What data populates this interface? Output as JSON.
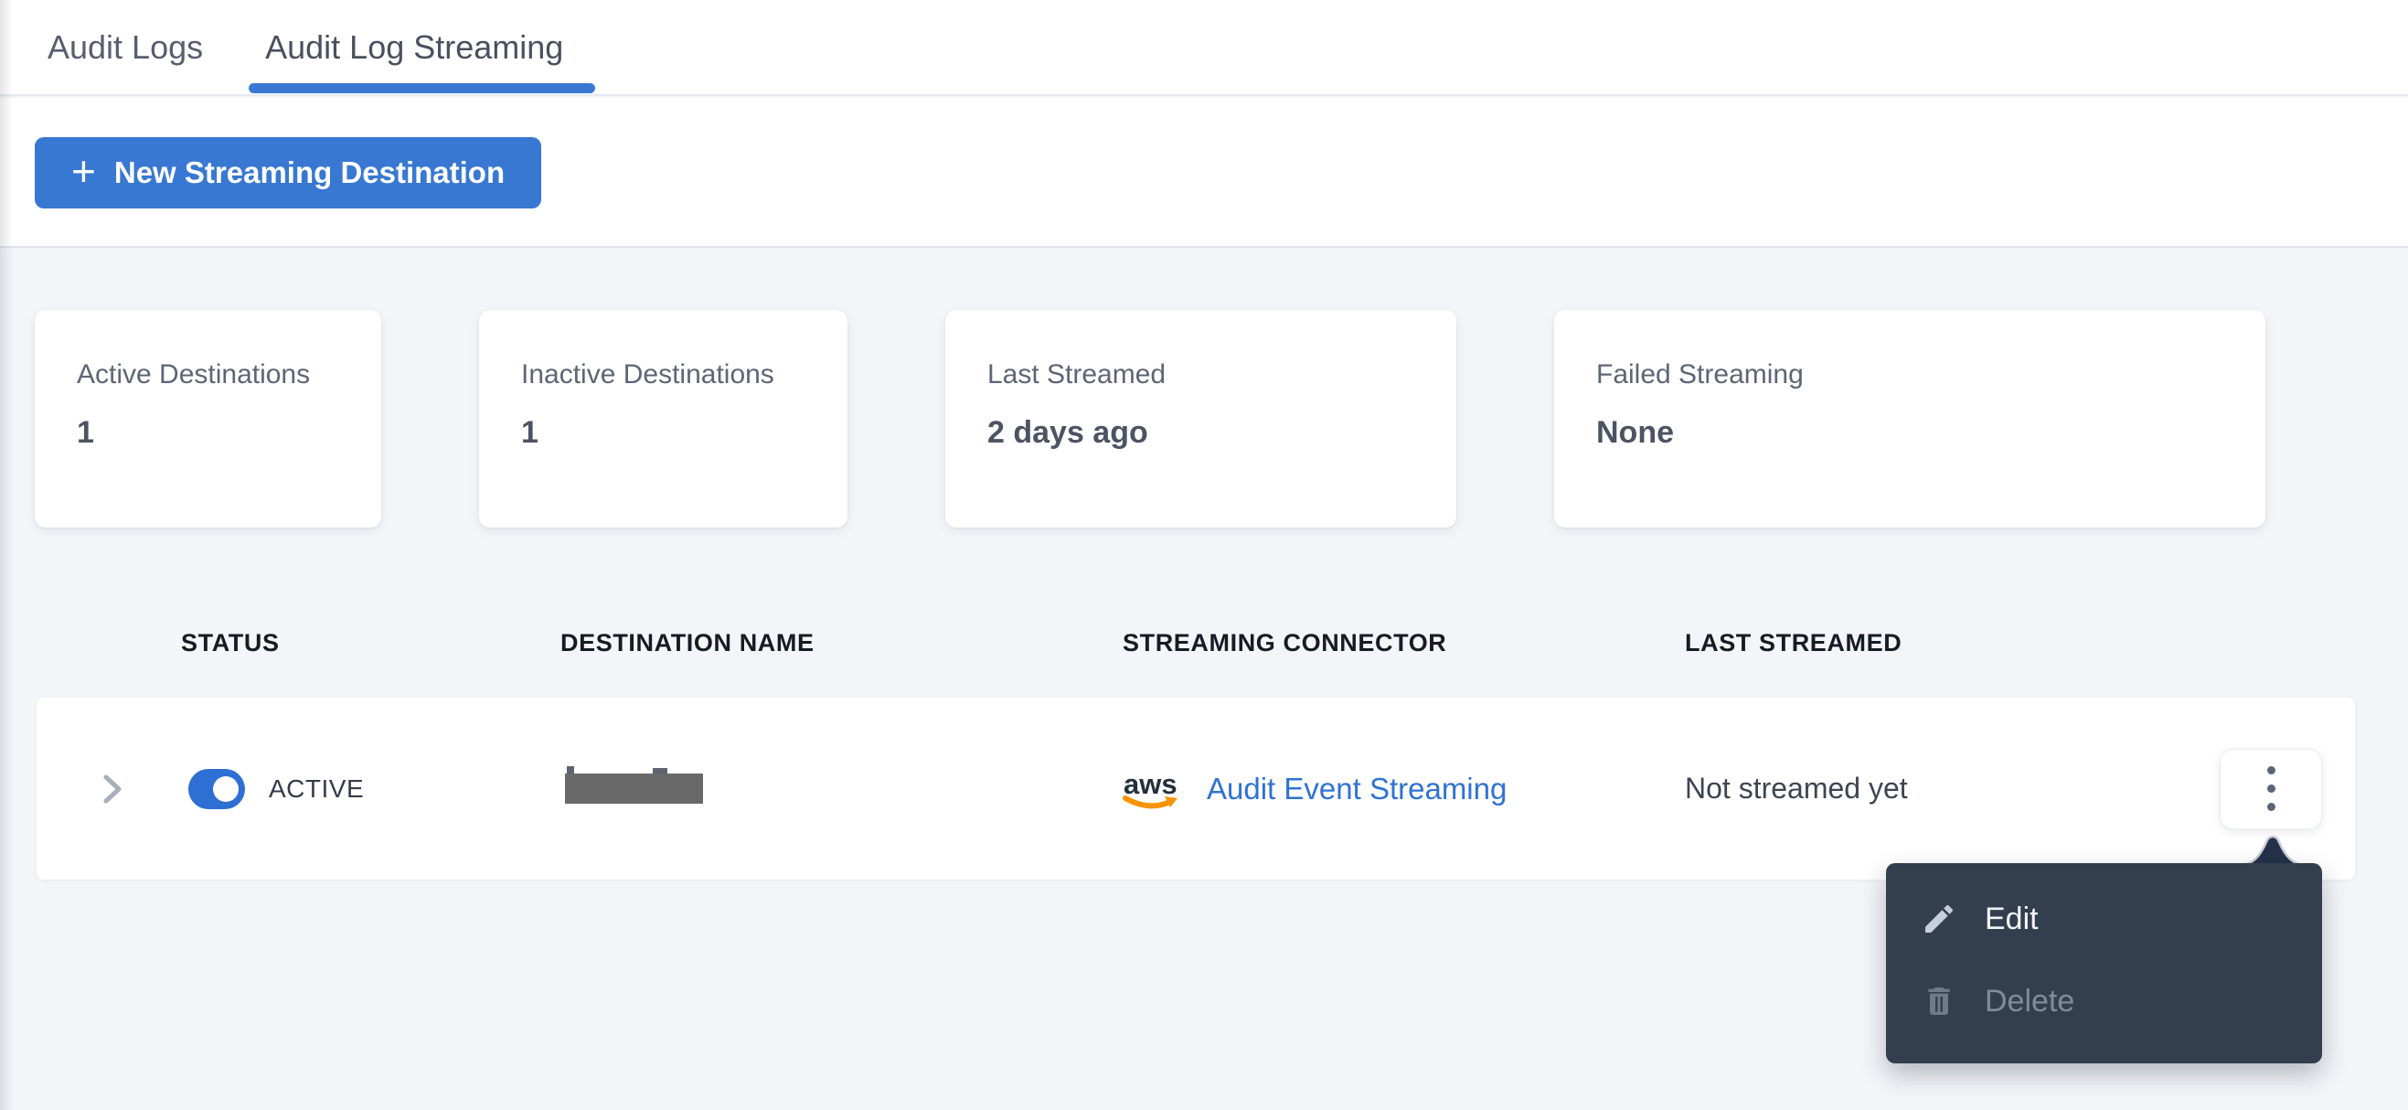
{
  "tabs": [
    {
      "label": "Audit Logs",
      "active": false
    },
    {
      "label": "Audit Log Streaming",
      "active": true
    }
  ],
  "toolbar": {
    "plus_glyph": "+",
    "new_destination_label": "New Streaming Destination"
  },
  "stats": [
    {
      "label": "Active Destinations",
      "value": "1"
    },
    {
      "label": "Inactive Destinations",
      "value": "1"
    },
    {
      "label": "Last Streamed",
      "value": "2 days ago"
    },
    {
      "label": "Failed Streaming",
      "value": "None"
    }
  ],
  "table": {
    "columns": [
      "STATUS",
      "DESTINATION NAME",
      "STREAMING CONNECTOR",
      "LAST STREAMED"
    ],
    "row": {
      "status_label": "ACTIVE",
      "status_on": true,
      "destination_name_redacted": true,
      "connector": {
        "provider": "aws",
        "label": "Audit Event Streaming"
      },
      "last_streamed": "Not streamed yet"
    }
  },
  "menu": {
    "items": [
      {
        "label": "Edit",
        "icon": "pencil-icon",
        "enabled": true
      },
      {
        "label": "Delete",
        "icon": "trash-icon",
        "enabled": false
      }
    ]
  },
  "colors": {
    "accent_blue": "#3878d2",
    "tab_underline_blue": "#3b78d4",
    "link_blue": "#2f72d3",
    "toggle_blue": "#2e6fd3",
    "menu_background": "#333e4e",
    "menu_arrow": "#243148",
    "redaction_gray": "#696969",
    "aws_navy": "#252f3e",
    "aws_orange": "#f79400",
    "page_background": "#f3f5f9"
  }
}
